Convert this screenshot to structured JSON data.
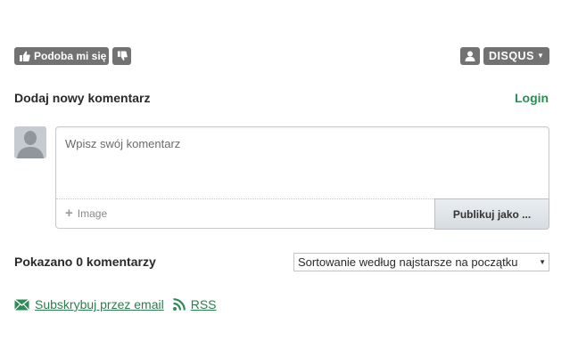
{
  "toolbar": {
    "like_label": "Podoba mi się",
    "brand_label": "DISQUS"
  },
  "form": {
    "title": "Dodaj nowy komentarz",
    "login_label": "Login",
    "placeholder": "Wpisz swój komentarz",
    "image_label": "Image",
    "publish_label": "Publikuj jako ..."
  },
  "comments": {
    "count_label": "Pokazano 0 komentarzy",
    "sort_selected": "Sortowanie według najstarsze na początku"
  },
  "subscribe": {
    "email_label": "Subskrybuj przez email",
    "rss_label": "RSS"
  },
  "colors": {
    "accent": "#2e8b57",
    "button_gray": "#727272"
  },
  "icons": [
    "thumbs-up-icon",
    "thumbs-down-icon",
    "user-icon",
    "chevron-down-icon",
    "plus-icon",
    "mail-icon",
    "rss-icon"
  ]
}
